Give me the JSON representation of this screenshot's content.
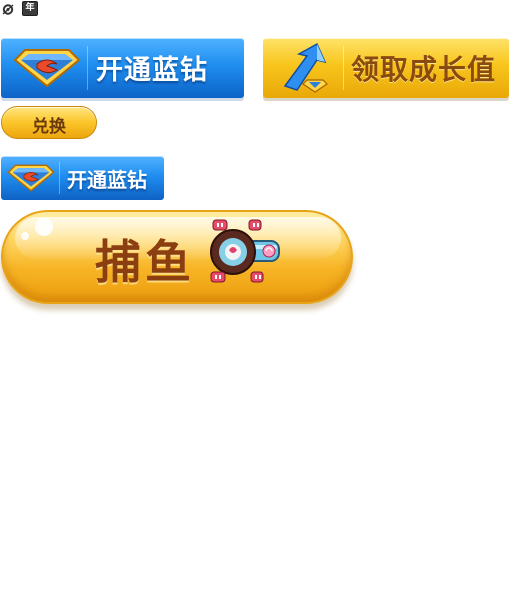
{
  "icons": {
    "top_left_1": "gear-icon",
    "top_left_2": "year-icon",
    "top_left_2_text": "年",
    "diamond": "blue-diamond-icon",
    "growth": "growth-arrow-icon",
    "cannon": "fish-cannon-icon"
  },
  "buttons": {
    "open_blue_diamond_large": "开通蓝钻",
    "claim_growth": "领取成长值",
    "exchange": "兑换",
    "open_blue_diamond_medium": "开通蓝钻",
    "fishing": "捕鱼"
  },
  "colors": {
    "blue": "#1f8ef0",
    "gold": "#f8c51c",
    "brown_text": "#8b4a0f"
  }
}
